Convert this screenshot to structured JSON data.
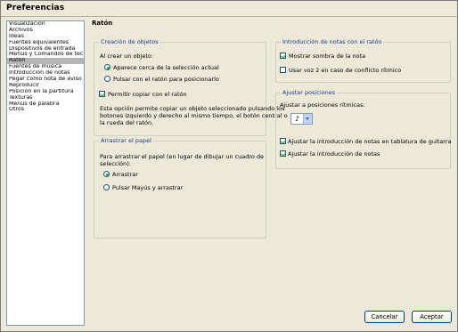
{
  "window": {
    "title": "Preferencias"
  },
  "sidebar": {
    "items": [
      {
        "label": "Visualización",
        "selected": false
      },
      {
        "label": "Archivos",
        "selected": false
      },
      {
        "label": "Ideas",
        "selected": false
      },
      {
        "label": "Fuentes equivalentes",
        "selected": false
      },
      {
        "label": "Dispositivos de entrada",
        "selected": false
      },
      {
        "label": "Menús y Comandos de teclado",
        "selected": false
      },
      {
        "label": "Ratón",
        "selected": true
      },
      {
        "label": "Fuentes de música",
        "selected": false
      },
      {
        "label": "Introducción de notas",
        "selected": false
      },
      {
        "label": "Pegar como nota de aviso",
        "selected": false
      },
      {
        "label": "Reproducir",
        "selected": false
      },
      {
        "label": "Posición en la partitura",
        "selected": false
      },
      {
        "label": "Texturas",
        "selected": false
      },
      {
        "label": "Menús de palabra",
        "selected": false
      },
      {
        "label": "Otros",
        "selected": false
      }
    ]
  },
  "main": {
    "title": "Ratón"
  },
  "creacion": {
    "title": "Creación de objetos",
    "intro": "Al crear un objeto:",
    "radio1": "Aparece cerca de la selección actual",
    "radio2": "Pulsar con el ratón para posicionarlo",
    "check": "Permitir copiar con el ratón",
    "desc1": "Esta opción permite copiar un objeto seleccionado pulsando los",
    "desc2": "botones izquierdo y derecho al mismo tiempo, el botón central o",
    "desc3": "la rueda del ratón."
  },
  "arrastrar": {
    "title": "Arrastrar el papel",
    "intro1": "Para arrastrar el papel (en lugar de dibujar un cuadro de",
    "intro2": "selección):",
    "radio1": "Arrastrar",
    "radio2": "Pulsar Mayús y arrastrar"
  },
  "notas": {
    "title": "Introducción de notas con el ratón",
    "check1": "Mostrar sombra de la nota",
    "check2": "Usar voz 2 en caso de conflicto rítmico"
  },
  "ajustar": {
    "title": "Ajustar posiciones",
    "label": "Ajustar a posiciones rítmicas:",
    "combo_value": "♪",
    "check1": "Ajustar la introducción de notas en tablatura de guitarra",
    "check2": "Ajustar la introducción de notas"
  },
  "buttons": {
    "cancel": "Cancelar",
    "accept": "Aceptar"
  }
}
